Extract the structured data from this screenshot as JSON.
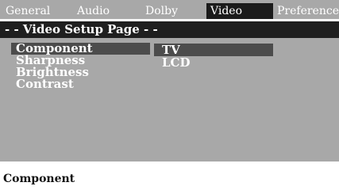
{
  "tabs": [
    {
      "label": "General",
      "active": false
    },
    {
      "label": "Audio",
      "active": false
    },
    {
      "label": "Dolby",
      "active": false
    },
    {
      "label": "Video",
      "active": true
    },
    {
      "label": "Preference",
      "active": false
    }
  ],
  "page_title": "- - Video Setup Page - -",
  "menu": {
    "items": [
      {
        "label": "Component",
        "selected": true
      },
      {
        "label": "Sharpness",
        "selected": false
      },
      {
        "label": "Brightness",
        "selected": false
      },
      {
        "label": "Contrast",
        "selected": false
      }
    ]
  },
  "options": {
    "items": [
      {
        "label": "TV",
        "highlighted": true
      },
      {
        "label": "LCD",
        "highlighted": false
      }
    ]
  },
  "status": {
    "text": "Component"
  },
  "colors": {
    "panel": "#a8a8a8",
    "active_tab": "#1b1b1b",
    "header": "#1f1f1f",
    "selection": "#4c4c4c",
    "text": "#ffffff"
  }
}
